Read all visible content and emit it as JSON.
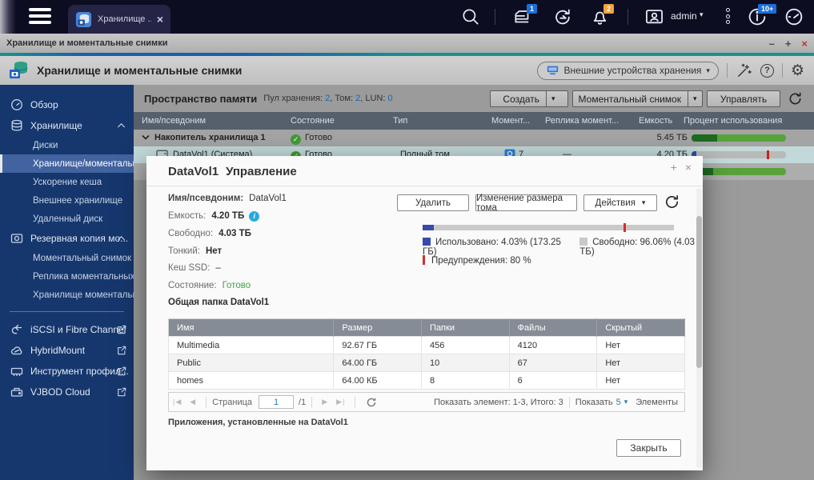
{
  "icons": {
    "gear": "⚙",
    "caret_down": "▾",
    "check": "✓",
    "close": "×",
    "minimize": "–",
    "maximize": "+",
    "question": "?",
    "info": "i",
    "plus": "+",
    "nav_first": "|◀",
    "nav_prev": "◀",
    "nav_next": "▶",
    "nav_last": "▶|"
  },
  "topbar": {
    "tab_label": "Хранилище ...",
    "admin_label": "admin",
    "tasks_badge": "1",
    "alerts_badge": "2",
    "updates_badge": "10+"
  },
  "titlebar": {
    "title": "Хранилище и моментальные снимки"
  },
  "app_header": {
    "title": "Хранилище и моментальные снимки",
    "device_button_label": "Внешние устройства хранения"
  },
  "sidebar": {
    "items": [
      {
        "label": "Обзор"
      },
      {
        "label": "Хранилище"
      },
      {
        "label": "Диски"
      },
      {
        "label": "Хранилище/моментальн..."
      },
      {
        "label": "Ускорение кеша"
      },
      {
        "label": "Внешнее хранилище"
      },
      {
        "label": "Удаленный диск"
      },
      {
        "label": "Резервная копия мо..."
      },
      {
        "label": "Моментальный снимок"
      },
      {
        "label": "Реплика моментальных ..."
      },
      {
        "label": "Хранилище моментальн..."
      },
      {
        "label": "iSCSI и Fibre Channel"
      },
      {
        "label": "HybridMount"
      },
      {
        "label": "Инструмент профил..."
      },
      {
        "label": "VJBOD Cloud"
      }
    ]
  },
  "toolbar": {
    "section_title": "Пространство памяти",
    "stats": [
      {
        "label": "Пул хранения:",
        "value": "2"
      },
      {
        "label": "Том:",
        "value": "2"
      },
      {
        "label": "LUN:",
        "value": "0"
      }
    ],
    "create_label": "Создать",
    "snapshot_label": "Моментальный снимок",
    "manage_label": "Управлять"
  },
  "storage_table": {
    "columns": [
      "Имя/псевдоним",
      "Состояние",
      "Тип",
      "Момент...",
      "Реплика момент...",
      "Емкость",
      "Процент использования"
    ],
    "rows": [
      {
        "name": "Накопитель хранилища 1",
        "state": "Готово",
        "capacity": "5.45 ТБ"
      },
      {
        "name": "DataVol1 (Система)",
        "state": "Готово",
        "type": "Полный том",
        "snapshots": "7",
        "replica": "—",
        "capacity": "4.20 ТБ"
      }
    ]
  },
  "dialog": {
    "title_name": "DataVol1",
    "title_action": "Управление",
    "fields": [
      {
        "label": "Имя/псевдоним:",
        "value": "DataVol1"
      },
      {
        "label": "Емкость:",
        "value": "4.20 ТБ"
      },
      {
        "label": "Свободно:",
        "value": "4.03 ТБ"
      },
      {
        "label": "Тонкий:",
        "value": "Нет"
      },
      {
        "label": "Кеш SSD:",
        "value": "–"
      },
      {
        "label": "Состояние:",
        "value": "Готово"
      }
    ],
    "shared_folder_heading": "Общая папка DataVol1",
    "delete_label": "Удалить",
    "resize_label": "Изменение размера тома",
    "actions_label": "Действия",
    "usage": {
      "used_pct": "4.03",
      "warning_pct": "80",
      "used_legend": "Использовано: 4.03% (173.25 ГБ)",
      "free_legend": "Свободно: 96.06% (4.03 ТБ)",
      "warning_legend": "Предупреждения: 80 %"
    },
    "shares_table": {
      "columns": [
        "Имя",
        "Размер",
        "Папки",
        "Файлы",
        "Скрытый"
      ],
      "rows": [
        {
          "name": "Multimedia",
          "size": "92.67 ГБ",
          "folders": "456",
          "files": "4120",
          "hidden": "Нет"
        },
        {
          "name": "Public",
          "size": "64.00 ГБ",
          "folders": "10",
          "files": "67",
          "hidden": "Нет"
        },
        {
          "name": "homes",
          "size": "64.00 КБ",
          "folders": "8",
          "files": "6",
          "hidden": "Нет"
        }
      ]
    },
    "pagination": {
      "page_label": "Страница",
      "page_value": "1",
      "page_total": "/1",
      "range_info": "Показать элемент: 1-3, Итого: 3",
      "show_label": "Показать",
      "show_value": "5",
      "items_label": "Элементы"
    },
    "apps_note": "Приложения, установленные на DataVol1",
    "close_label": "Закрыть"
  }
}
